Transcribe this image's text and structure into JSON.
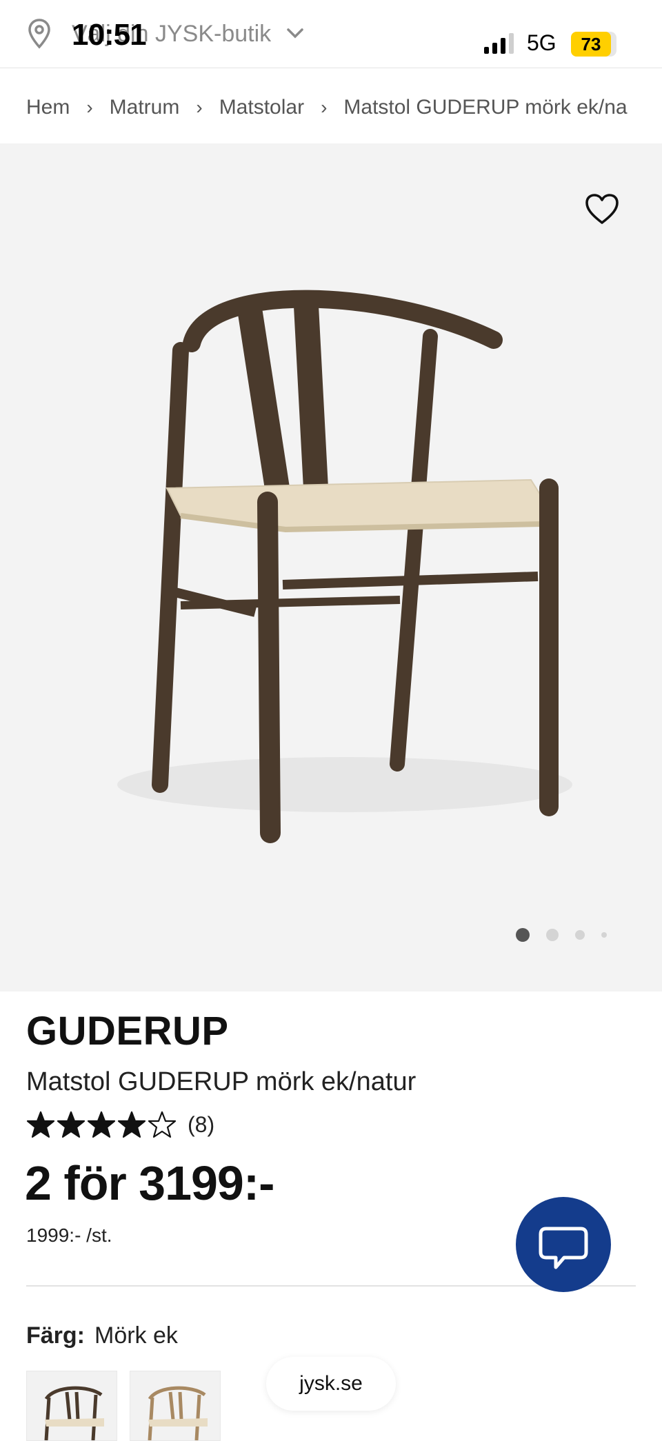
{
  "status_bar": {
    "time": "10:51",
    "network": "5G",
    "battery": "73"
  },
  "store": {
    "label": "Välj din JYSK-butik"
  },
  "breadcrumb": [
    "Hem",
    "Matrum",
    "Matstolar",
    "Matstol GUDERUP mörk ek/na"
  ],
  "gallery": {
    "image_count": 4,
    "active_index": 0
  },
  "product": {
    "brand": "GUDERUP",
    "name": "Matstol GUDERUP mörk ek/natur",
    "rating": 4,
    "rating_max": 5,
    "review_count": "(8)",
    "price": "2 för 3199:-",
    "unit_price": "1999:- /st.",
    "color_label": "Färg:",
    "color_value": "Mörk ek"
  },
  "browser": {
    "url": "jysk.se"
  },
  "colors": {
    "accent_blue": "#143c8c",
    "battery_yellow": "#ffcf00",
    "wood": "#4a3a2c",
    "seat": "#e8dcc4"
  }
}
